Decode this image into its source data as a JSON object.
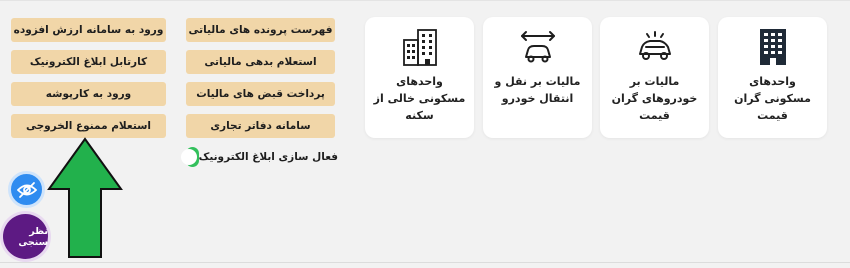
{
  "cards": [
    {
      "icon": "building-dark-icon",
      "label": "واحدهای مسکونی گران قیمت"
    },
    {
      "icon": "luxury-car-icon",
      "label": "مالیات بر خودروهای گران قیمت"
    },
    {
      "icon": "car-transfer-icon",
      "label": "مالیات بر نقل و انتقال خودرو"
    },
    {
      "icon": "building-outline-icon",
      "label": "واحدهای مسکونی خالی از سکنه"
    }
  ],
  "middle_buttons": [
    "فهرست پرونده های مالیاتی",
    "استعلام بدهی مالیاتی",
    "پرداخت قبض های مالیات",
    "سامانه دفاتر تجاری"
  ],
  "left_buttons": [
    "ورود به سامانه ارزش افزوده",
    "کارتابل ابلاغ الکترونیک",
    "ورود به کارپوشه",
    "استعلام ممنوع الخروجی"
  ],
  "toggle": {
    "label": "فعال سازی ابلاغ الکترونیک",
    "state": "on"
  },
  "survey_button": "نظر سنجی",
  "accessibility_icon": "eye-off-icon",
  "colors": {
    "button_bg": "#f1d6a8",
    "toggle_on": "#33c05c",
    "eye_button": "#2f8cf0",
    "survey_button": "#5d1a83",
    "arrow": "#22b14c"
  }
}
